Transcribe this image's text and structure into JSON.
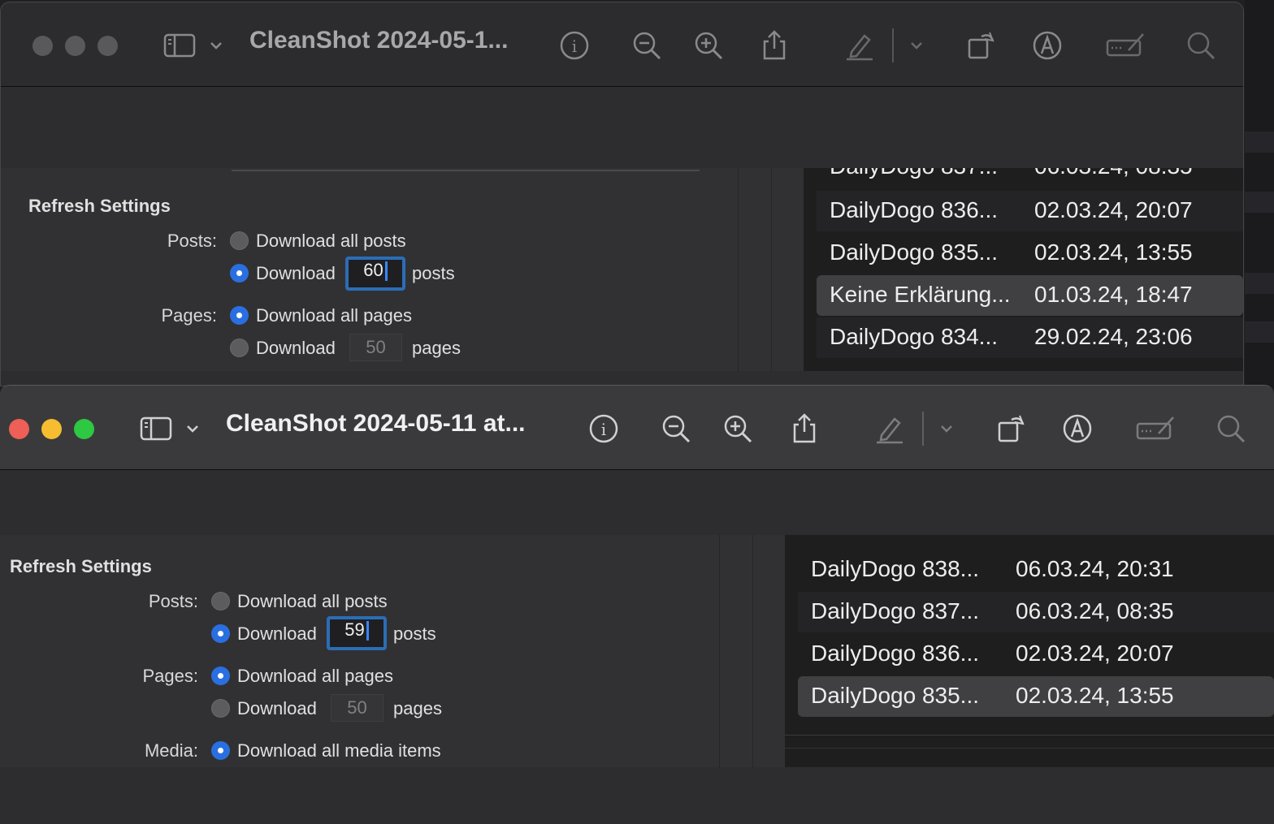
{
  "back_window": {
    "title": "CleanShot 2024-05-1...",
    "refresh_heading": "Refresh Settings",
    "posts_label": "Posts:",
    "opt_all_posts": "Download all posts",
    "opt_download": "Download",
    "posts_value": "60",
    "posts_suffix": "posts",
    "pages_label": "Pages:",
    "opt_all_pages": "Download all pages",
    "pages_value": "50",
    "pages_suffix": "pages",
    "list_clipped": {
      "name": "DailyDogo 837...",
      "date": "06.03.24, 08:35"
    },
    "list": [
      {
        "name": "DailyDogo 836...",
        "date": "02.03.24, 20:07"
      },
      {
        "name": "DailyDogo 835...",
        "date": "02.03.24, 13:55"
      },
      {
        "name": "Keine Erklärung...",
        "date": "01.03.24, 18:47"
      },
      {
        "name": "DailyDogo 834...",
        "date": "29.02.24, 23:06"
      }
    ]
  },
  "front_window": {
    "title": "CleanShot 2024-05-11 at...",
    "refresh_heading": "Refresh Settings",
    "posts_label": "Posts:",
    "opt_all_posts": "Download all posts",
    "opt_download": "Download",
    "posts_value": "59",
    "posts_suffix": "posts",
    "pages_label": "Pages:",
    "opt_all_pages": "Download all pages",
    "pages_value": "50",
    "pages_suffix": "pages",
    "media_label": "Media:",
    "opt_all_media": "Download all media items",
    "list": [
      {
        "name": "DailyDogo 838...",
        "date": "06.03.24, 20:31"
      },
      {
        "name": "DailyDogo 837...",
        "date": "06.03.24, 08:35"
      },
      {
        "name": "DailyDogo 836...",
        "date": "02.03.24, 20:07"
      },
      {
        "name": "DailyDogo 835...",
        "date": "02.03.24, 13:55"
      }
    ]
  },
  "colors": {
    "accent": "#2a6fe0",
    "close": "#ee5f57",
    "minimize": "#f5bd2f",
    "zoom": "#2ec842"
  }
}
